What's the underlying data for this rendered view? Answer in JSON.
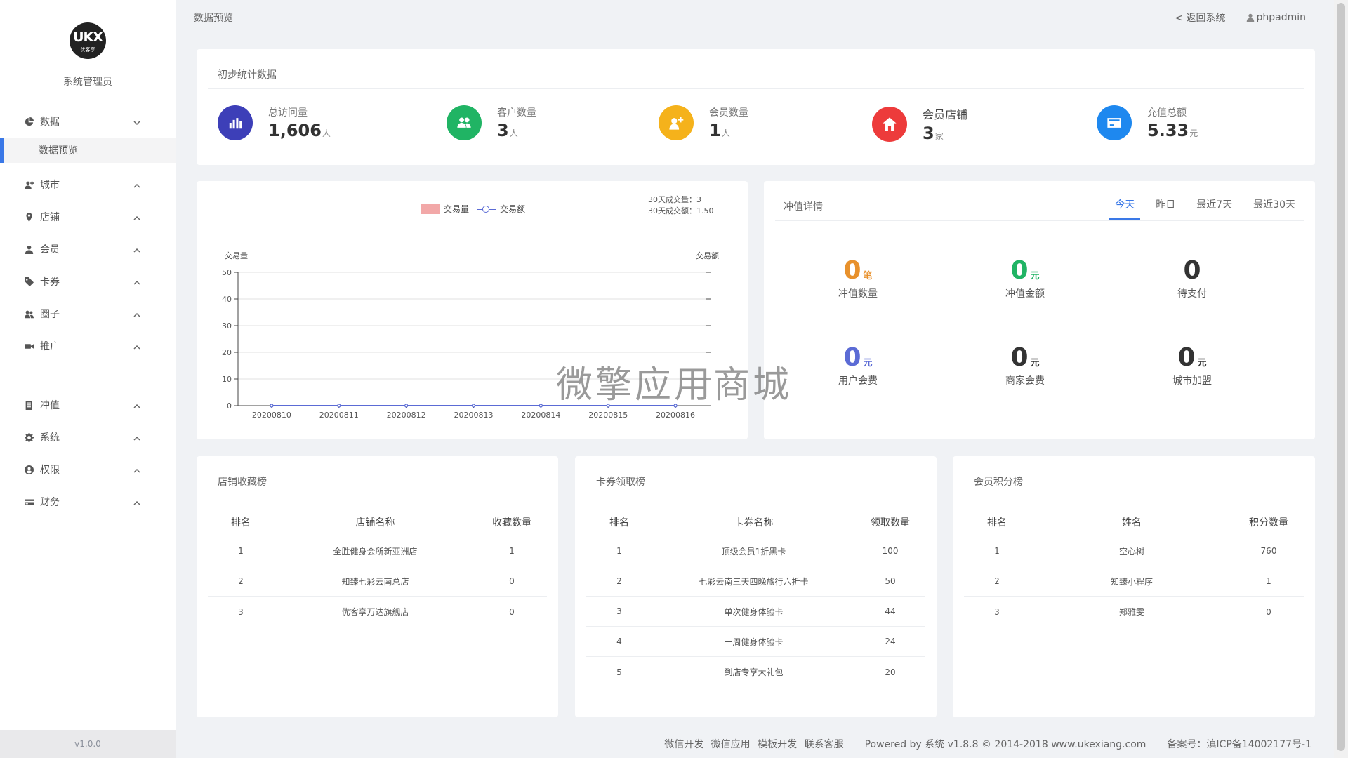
{
  "sidebar": {
    "logo_text": "UKX",
    "logo_sub": "优客享",
    "role": "系统管理员",
    "version": "v1.0.0",
    "menu": [
      {
        "label": "数据",
        "icon": "pie-chart-icon",
        "expanded": true
      },
      {
        "label": "城市",
        "icon": "user-plus-icon"
      },
      {
        "label": "店铺",
        "icon": "map-pin-icon"
      },
      {
        "label": "会员",
        "icon": "user-icon"
      },
      {
        "label": "卡券",
        "icon": "tag-icon"
      },
      {
        "label": "圈子",
        "icon": "users-icon"
      },
      {
        "label": "推广",
        "icon": "video-icon"
      },
      {
        "label": "冲值",
        "icon": "book-icon"
      },
      {
        "label": "系统",
        "icon": "gear-icon"
      },
      {
        "label": "权限",
        "icon": "user-circle-icon"
      },
      {
        "label": "财务",
        "icon": "credit-card-icon"
      }
    ],
    "active_sub": "数据预览"
  },
  "topbar": {
    "page_title": "数据预览",
    "back_label": "< 返回系统",
    "user_label": "phpadmin"
  },
  "stats": {
    "title": "初步统计数据",
    "items": [
      {
        "label": "总访问量",
        "value": "1,606",
        "unit": "人",
        "color": "#3d3fb8",
        "icon": "bar-chart-icon"
      },
      {
        "label": "客户数量",
        "value": "3",
        "unit": "人",
        "color": "#20b464",
        "icon": "users-icon"
      },
      {
        "label": "会员数量",
        "value": "1",
        "unit": "人",
        "color": "#f5b21b",
        "icon": "user-plus-icon"
      },
      {
        "label": "会员店铺",
        "value": "3",
        "unit": "家",
        "color": "#ed3b3b",
        "icon": "store-icon"
      },
      {
        "label": "充值总额",
        "value": "5.33",
        "unit": "元",
        "color": "#1e88ef",
        "icon": "card-icon"
      }
    ]
  },
  "chart": {
    "legend_bar": "交易量",
    "legend_line": "交易额",
    "note_1": "30天成交量：3",
    "note_2": "30天成交额：1.50"
  },
  "chart_data": {
    "type": "bar",
    "categories": [
      "20200810",
      "20200811",
      "20200812",
      "20200813",
      "20200814",
      "20200815",
      "20200816"
    ],
    "series": [
      {
        "name": "交易量",
        "type": "bar",
        "values": [
          0,
          0,
          0,
          0,
          0,
          0,
          0
        ],
        "color": "#f2a8a8"
      },
      {
        "name": "交易额",
        "type": "line",
        "values": [
          0,
          0,
          0,
          0,
          0,
          0,
          0
        ],
        "color": "#5b6bd5"
      }
    ],
    "ylabel": "交易量",
    "y2label": "交易额",
    "ylim": [
      0,
      50
    ],
    "yticks": [
      0,
      10,
      20,
      30,
      40,
      50
    ],
    "grid": true,
    "legend_position": "top"
  },
  "recharge": {
    "title": "冲值详情",
    "tabs": [
      "今天",
      "昨日",
      "最近7天",
      "最近30天"
    ],
    "active_tab": 0,
    "items": [
      {
        "value": "0",
        "unit": "笔",
        "label": "冲值数量",
        "color": "#e8912c"
      },
      {
        "value": "0",
        "unit": "元",
        "label": "冲值金额",
        "color": "#20b464"
      },
      {
        "value": "0",
        "unit": "",
        "label": "待支付",
        "color": "#333333"
      },
      {
        "value": "0",
        "unit": "元",
        "label": "用户会费",
        "color": "#5b6bd5"
      },
      {
        "value": "0",
        "unit": "元",
        "label": "商家会费",
        "color": "#333333"
      },
      {
        "value": "0",
        "unit": "元",
        "label": "城市加盟",
        "color": "#333333"
      }
    ]
  },
  "store_rank": {
    "title": "店铺收藏榜",
    "headers": [
      "排名",
      "店铺名称",
      "收藏数量"
    ],
    "rows": [
      [
        "1",
        "全胜健身会所新亚洲店",
        "1"
      ],
      [
        "2",
        "知臻七彩云南总店",
        "0"
      ],
      [
        "3",
        "优客享万达旗舰店",
        "0"
      ]
    ]
  },
  "coupon_rank": {
    "title": "卡券领取榜",
    "headers": [
      "排名",
      "卡券名称",
      "领取数量"
    ],
    "rows": [
      [
        "1",
        "顶级会员1折黑卡",
        "100"
      ],
      [
        "2",
        "七彩云南三天四晚旅行六折卡",
        "50"
      ],
      [
        "3",
        "单次健身体验卡",
        "44"
      ],
      [
        "4",
        "一周健身体验卡",
        "24"
      ],
      [
        "5",
        "到店专享大礼包",
        "20"
      ]
    ]
  },
  "member_rank": {
    "title": "会员积分榜",
    "headers": [
      "排名",
      "姓名",
      "积分数量"
    ],
    "rows": [
      [
        "1",
        "空心树",
        "760"
      ],
      [
        "2",
        "知臻小程序",
        "1"
      ],
      [
        "3",
        "郑雅雯",
        "0"
      ]
    ]
  },
  "footer": {
    "links": [
      "微信开发",
      "微信应用",
      "模板开发",
      "联系客服"
    ],
    "powered": "Powered by 系统 v1.8.8 © 2014-2018 www.ukexiang.com",
    "icp": "备案号：滇ICP备14002177号-1"
  },
  "watermark": "微擎应用商城"
}
